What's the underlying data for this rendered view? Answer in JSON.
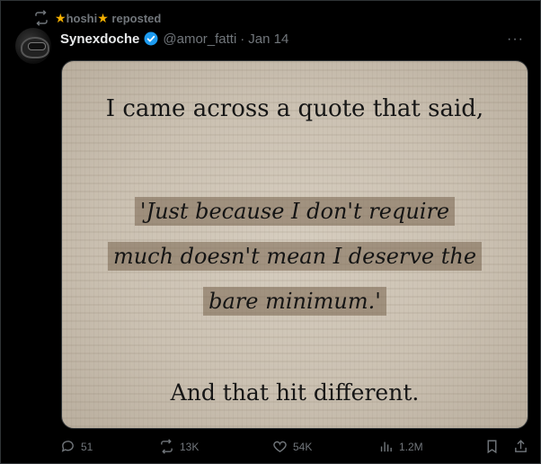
{
  "repost": {
    "user": "hoshi",
    "label": "reposted",
    "star_left": "★",
    "star_right": "★",
    "icon": "repost-icon"
  },
  "post": {
    "display_name": "Synexdoche",
    "handle": "@amor_fatti",
    "separator": "·",
    "date": "Jan 14",
    "more_label": "···",
    "verified": true,
    "image": {
      "line1": "I came across a quote that said,",
      "quote_lines": [
        "'Just because I don't require",
        "much doesn't mean I deserve the",
        "bare minimum.'"
      ],
      "line3": "And that hit different."
    }
  },
  "actions": {
    "replies": "51",
    "reposts": "13K",
    "likes": "54K",
    "views": "1.2M"
  },
  "colors": {
    "background": "#000000",
    "text": "#e7e9ea",
    "muted": "#71767b",
    "verified": "#1d9bf0",
    "star": "#f5b000"
  }
}
